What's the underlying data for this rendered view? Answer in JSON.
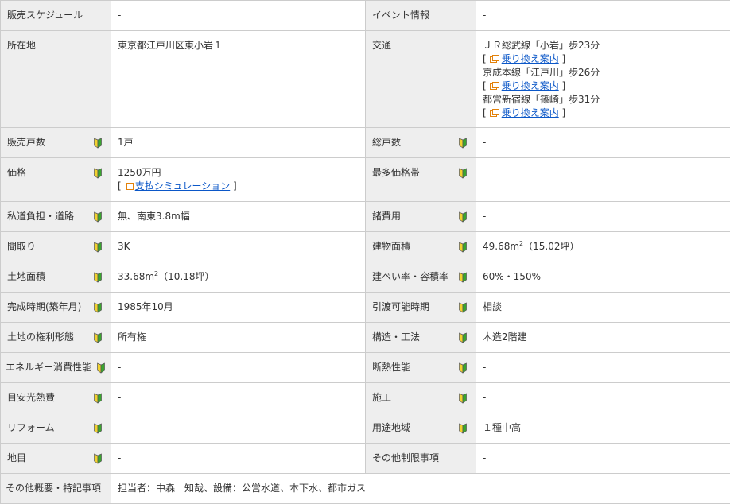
{
  "rows": [
    {
      "l_label": "販売スケジュール",
      "l_value": "-",
      "r_label": "イベント情報",
      "r_value": "-"
    },
    {
      "l_label": "所在地",
      "l_value": "東京都江戸川区東小岩１",
      "r_label": "交通",
      "transit": [
        {
          "line": "ＪＲ総武線「小岩」歩23分",
          "link": "乗り換え案内"
        },
        {
          "line": "京成本線「江戸川」歩26分",
          "link": "乗り換え案内"
        },
        {
          "line": "都営新宿線「篠崎」歩31分",
          "link": "乗り換え案内"
        }
      ]
    },
    {
      "l_label": "販売戸数",
      "l_value": "1戸",
      "r_label": "総戸数",
      "r_value": "-"
    },
    {
      "l_label": "価格",
      "l_value": "1250万円",
      "l_link": "支払シミュレーション",
      "r_label": "最多価格帯",
      "r_value": "-"
    },
    {
      "l_label": "私道負担・道路",
      "l_value": "無、南東3.8m幅",
      "r_label": "諸費用",
      "r_value": "-"
    },
    {
      "l_label": "間取り",
      "l_value": "3K",
      "r_label": "建物面積",
      "r_value": "49.68m",
      "r_sup": "2",
      "r_suffix": "（15.02坪）"
    },
    {
      "l_label": "土地面積",
      "l_value": "33.68m",
      "l_sup": "2",
      "l_suffix": "（10.18坪）",
      "r_label": "建ぺい率・容積率",
      "r_value": "60%・150%"
    },
    {
      "l_label": "完成時期(築年月)",
      "l_value": "1985年10月",
      "r_label": "引渡可能時期",
      "r_value": "相談"
    },
    {
      "l_label": "土地の権利形態",
      "l_value": "所有権",
      "r_label": "構造・工法",
      "r_value": "木造2階建"
    },
    {
      "l_label": "エネルギー消費性能",
      "l_value": "-",
      "r_label": "断熱性能",
      "r_value": "-"
    },
    {
      "l_label": "目安光熱費",
      "l_value": "-",
      "r_label": "施工",
      "r_value": "-"
    },
    {
      "l_label": "リフォーム",
      "l_value": "-",
      "r_label": "用途地域",
      "r_value": "１種中高"
    },
    {
      "l_label": "地目",
      "l_value": "-",
      "r_label": "その他制限事項",
      "r_value": "-"
    }
  ],
  "footer": {
    "label": "その他概要・特記事項",
    "value": "担当者：中森　知哉、設備：公営水道、本下水、都市ガス"
  },
  "brackets": {
    "open": "[",
    "close": "]"
  },
  "colors": {
    "header_bg": "#eeeeee",
    "border": "#cccccc",
    "link": "#0b57c8",
    "icon_orange": "#e3820b",
    "mark_green": "#3aa52f",
    "mark_yellow": "#f2d22e"
  },
  "icons": {
    "beginner": "beginner-mark-icon",
    "transit": "external-window-icon",
    "simulation": "simulation-square-icon"
  }
}
